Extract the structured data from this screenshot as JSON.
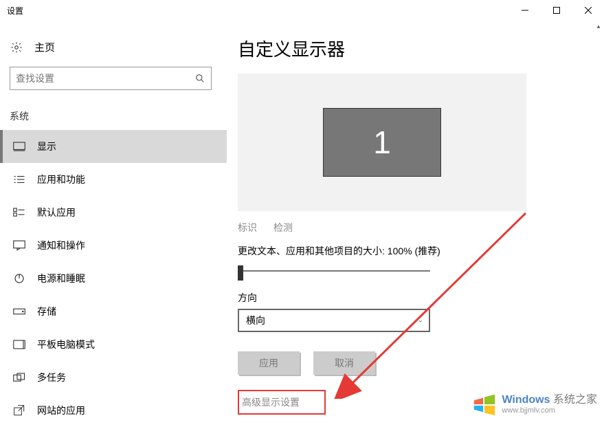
{
  "titlebar": {
    "title": "设置"
  },
  "sidebar": {
    "home": "主页",
    "search_placeholder": "查找设置",
    "section": "系统",
    "items": [
      {
        "label": "显示"
      },
      {
        "label": "应用和功能"
      },
      {
        "label": "默认应用"
      },
      {
        "label": "通知和操作"
      },
      {
        "label": "电源和睡眠"
      },
      {
        "label": "存储"
      },
      {
        "label": "平板电脑模式"
      },
      {
        "label": "多任务"
      },
      {
        "label": "网站的应用"
      }
    ]
  },
  "main": {
    "title": "自定义显示器",
    "monitor_number": "1",
    "identify": "标识",
    "detect": "检测",
    "scale_label": "更改文本、应用和其他项目的大小: 100% (推荐)",
    "orientation_label": "方向",
    "orientation_value": "横向",
    "apply": "应用",
    "cancel": "取消",
    "advanced": "高级显示设置"
  },
  "watermark": {
    "brand1": "Windows",
    "brand2": "系统之家",
    "url": "www.bjjmlv.com"
  }
}
